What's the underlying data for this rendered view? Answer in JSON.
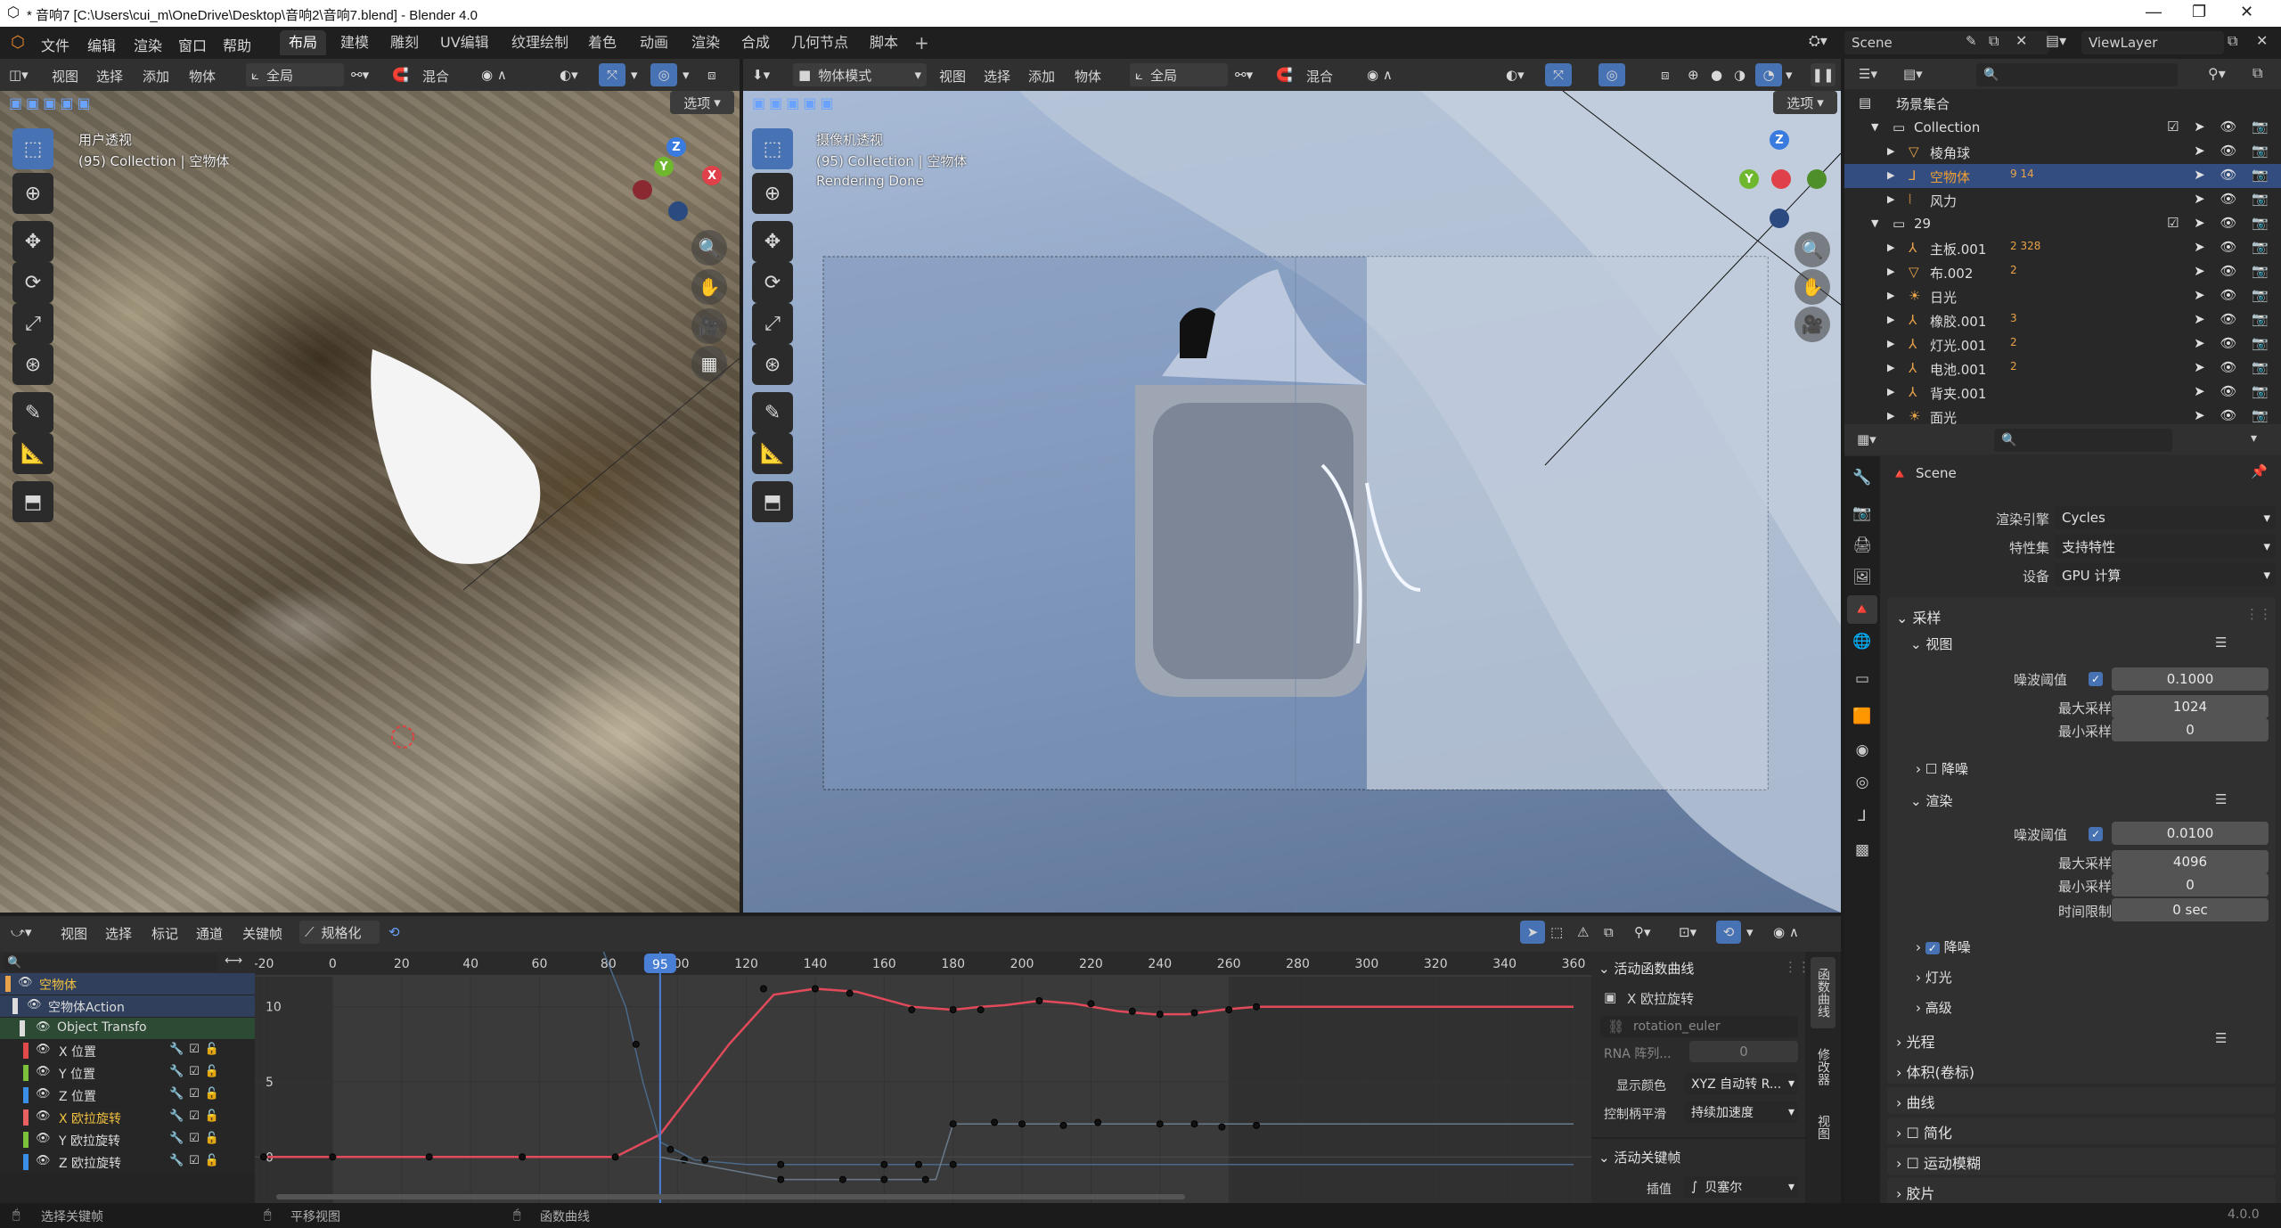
{
  "window": {
    "title": "* 音响7 [C:\\Users\\cui_m\\OneDrive\\Desktop\\音响2\\音响7.blend] - Blender 4.0",
    "controls": [
      "—",
      "❐",
      "✕"
    ]
  },
  "menu": [
    "文件",
    "编辑",
    "渲染",
    "窗口",
    "帮助"
  ],
  "workspaces": [
    "布局",
    "建模",
    "雕刻",
    "UV编辑",
    "纹理绘制",
    "着色",
    "动画",
    "渲染",
    "合成",
    "几何节点",
    "脚本"
  ],
  "active_workspace": "布局",
  "scene_field": "Scene",
  "viewlayer_field": "ViewLayer",
  "viewport_left": {
    "menus": [
      "视图",
      "选择",
      "添加",
      "物体"
    ],
    "transform": "全局",
    "blend": "混合",
    "options": "选项",
    "view_name": "用户透视",
    "collection_info": "(95) Collection | 空物体"
  },
  "viewport_right": {
    "mode": "物体模式",
    "menus": [
      "视图",
      "选择",
      "添加",
      "物体"
    ],
    "transform": "全局",
    "blend": "混合",
    "options": "选项",
    "view_name": "摄像机透视",
    "collection_info": "(95) Collection | 空物体",
    "render_status": "Rendering Done"
  },
  "outliner": {
    "root": "场景集合",
    "rows": [
      {
        "label": "Collection",
        "level": 1,
        "icon": "collection-icon"
      },
      {
        "label": "棱角球",
        "level": 2,
        "icon": "mesh-icon"
      },
      {
        "label": "空物体",
        "level": 2,
        "icon": "empty-icon",
        "selected": true,
        "extra": "9 14"
      },
      {
        "label": "风力",
        "level": 2,
        "icon": "force-icon"
      },
      {
        "label": "29",
        "level": 1,
        "icon": "collection-icon"
      },
      {
        "label": "主板.001",
        "level": 2,
        "icon": "armature-icon",
        "extra": "2 328"
      },
      {
        "label": "布.002",
        "level": 2,
        "icon": "mesh-icon",
        "extra": "2"
      },
      {
        "label": "日光",
        "level": 2,
        "icon": "light-icon"
      },
      {
        "label": "橡胶.001",
        "level": 2,
        "icon": "armature-icon",
        "extra": "3"
      },
      {
        "label": "灯光.001",
        "level": 2,
        "icon": "armature-icon",
        "extra": "2"
      },
      {
        "label": "电池.001",
        "level": 2,
        "icon": "armature-icon",
        "extra": "2"
      },
      {
        "label": "背夹.001",
        "level": 2,
        "icon": "armature-icon"
      },
      {
        "label": "面光",
        "level": 2,
        "icon": "light-icon"
      }
    ]
  },
  "properties": {
    "context": "Scene",
    "render_engine_label": "渲染引擎",
    "render_engine": "Cycles",
    "feature_set_label": "特性集",
    "feature_set": "支持特性",
    "device_label": "设备",
    "device": "GPU 计算",
    "sampling": "采样",
    "viewport": "视图",
    "noise_threshold_label": "噪波阈值",
    "vp_noise_threshold": "0.1000",
    "max_samples_label": "最大采样",
    "vp_max_samples": "1024",
    "min_samples_label": "最小采样",
    "vp_min_samples": "0",
    "denoise": "降噪",
    "render": "渲染",
    "r_noise_threshold": "0.0100",
    "r_max_samples": "4096",
    "r_min_samples": "0",
    "time_limit_label": "时间限制",
    "time_limit": "0 sec",
    "denoise2": "降噪",
    "lights": "灯光",
    "advanced": "高级",
    "light_paths": "光程",
    "volumes": "体积(卷标)",
    "curves": "曲线",
    "simplify": "简化",
    "motion_blur": "运动模糊",
    "film": "胶片"
  },
  "graph_editor": {
    "menus": [
      "视图",
      "选择",
      "标记",
      "通道",
      "关键帧"
    ],
    "normalize": "规格化",
    "current_frame": "95",
    "frame_ticks": [
      "-20",
      "0",
      "20",
      "40",
      "60",
      "80",
      "100",
      "120",
      "140",
      "160",
      "180",
      "200",
      "220",
      "240",
      "260",
      "280",
      "300",
      "320",
      "340",
      "360"
    ],
    "value_ticks": [
      "10",
      "5",
      "0"
    ],
    "channels": [
      {
        "label": "空物体",
        "color": "#e8a34a"
      },
      {
        "label": "空物体Action",
        "color": "#dcdcdc"
      },
      {
        "label": "Object Transfo",
        "color": "#dcdcdc"
      },
      {
        "label": "X 位置",
        "color": "#e04a4a"
      },
      {
        "label": "Y 位置",
        "color": "#7bc23a"
      },
      {
        "label": "Z 位置",
        "color": "#3a8ee6"
      },
      {
        "label": "X 欧拉旋转",
        "color": "#e86060"
      },
      {
        "label": "Y 欧拉旋转",
        "color": "#7bc23a"
      },
      {
        "label": "Z 欧拉旋转",
        "color": "#3a8ee6"
      }
    ],
    "npanel": {
      "active_fcurve": "活动函数曲线",
      "channel_name": "X 欧拉旋转",
      "rna_path": "rotation_euler",
      "rna_array_label": "RNA 阵列...",
      "rna_array_index": "0",
      "display_color_label": "显示颜色",
      "display_color": "XYZ 自动转 R...",
      "handle_smoothing_label": "控制柄平滑",
      "handle_smoothing": "持续加速度",
      "active_keyframe": "活动关键帧",
      "interpolation_label": "插值",
      "interpolation": "贝塞尔"
    },
    "side_tabs": [
      "函数曲线",
      "修改器",
      "视图"
    ]
  },
  "chart_data": {
    "type": "line",
    "x_range": [
      -20,
      360
    ],
    "y_range": [
      -2,
      12
    ],
    "series": [
      {
        "name": "X 欧拉旋转",
        "color": "#e04a5a",
        "points": [
          [
            -20,
            0
          ],
          [
            0,
            0
          ],
          [
            28,
            0
          ],
          [
            55,
            0
          ],
          [
            82,
            0
          ],
          [
            95,
            1.5
          ],
          [
            115,
            7.5
          ],
          [
            128,
            10.8
          ],
          [
            140,
            11.2
          ],
          [
            152,
            11.0
          ],
          [
            168,
            10.0
          ],
          [
            180,
            9.8
          ],
          [
            188,
            10.0
          ],
          [
            195,
            10.1
          ],
          [
            205,
            10.4
          ],
          [
            215,
            10.2
          ],
          [
            228,
            9.7
          ],
          [
            238,
            9.5
          ],
          [
            248,
            9.5
          ],
          [
            258,
            9.8
          ],
          [
            268,
            10.0
          ],
          [
            285,
            10.0
          ],
          [
            360,
            10.0
          ]
        ],
        "keys": [
          [
            -20,
            0
          ],
          [
            0,
            0
          ],
          [
            28,
            0
          ],
          [
            55,
            0
          ],
          [
            82,
            0
          ],
          [
            125,
            11.2
          ],
          [
            140,
            11.2
          ],
          [
            150,
            10.9
          ],
          [
            168,
            9.8
          ],
          [
            180,
            9.8
          ],
          [
            188,
            9.8
          ],
          [
            205,
            10.4
          ],
          [
            220,
            10.2
          ],
          [
            232,
            9.7
          ],
          [
            240,
            9.5
          ],
          [
            250,
            9.6
          ],
          [
            260,
            9.8
          ],
          [
            268,
            10.0
          ]
        ]
      },
      {
        "name": "Y 欧拉旋转",
        "color": "#4a6a8a",
        "points": [
          [
            78,
            15
          ],
          [
            85,
            10
          ],
          [
            90,
            5
          ],
          [
            95,
            1
          ],
          [
            105,
            -0.2
          ],
          [
            120,
            -0.5
          ],
          [
            160,
            -0.5
          ],
          [
            180,
            -0.5
          ],
          [
            260,
            -0.5
          ],
          [
            360,
            -0.5
          ]
        ],
        "keys": [
          [
            88,
            7.5
          ],
          [
            98,
            0.5
          ],
          [
            102,
            -0.2
          ],
          [
            108,
            -0.2
          ],
          [
            130,
            -0.5
          ],
          [
            160,
            -0.5
          ],
          [
            170,
            -0.5
          ],
          [
            180,
            -0.5
          ]
        ]
      },
      {
        "name": "Z 欧拉旋转",
        "color": "#6a7a8a",
        "points": [
          [
            95,
            0
          ],
          [
            130,
            -1.5
          ],
          [
            175,
            -1.5
          ],
          [
            180,
            2.2
          ],
          [
            260,
            2.2
          ],
          [
            360,
            2.2
          ]
        ],
        "keys": [
          [
            130,
            -1.5
          ],
          [
            148,
            -1.5
          ],
          [
            160,
            -1.5
          ],
          [
            172,
            -1.5
          ],
          [
            180,
            2.2
          ],
          [
            192,
            2.3
          ],
          [
            200,
            2.2
          ],
          [
            212,
            2.1
          ],
          [
            222,
            2.3
          ],
          [
            240,
            2.2
          ],
          [
            250,
            2.2
          ],
          [
            258,
            2.0
          ],
          [
            268,
            2.1
          ]
        ]
      }
    ]
  },
  "status_bar": {
    "left": "选择关键帧",
    "middle": "平移视图",
    "right": "函数曲线",
    "version": "4.0.0"
  },
  "colors": {
    "accent": "#4772b3",
    "selected_row": "#334d80",
    "playhead": "#4a7fd6"
  }
}
